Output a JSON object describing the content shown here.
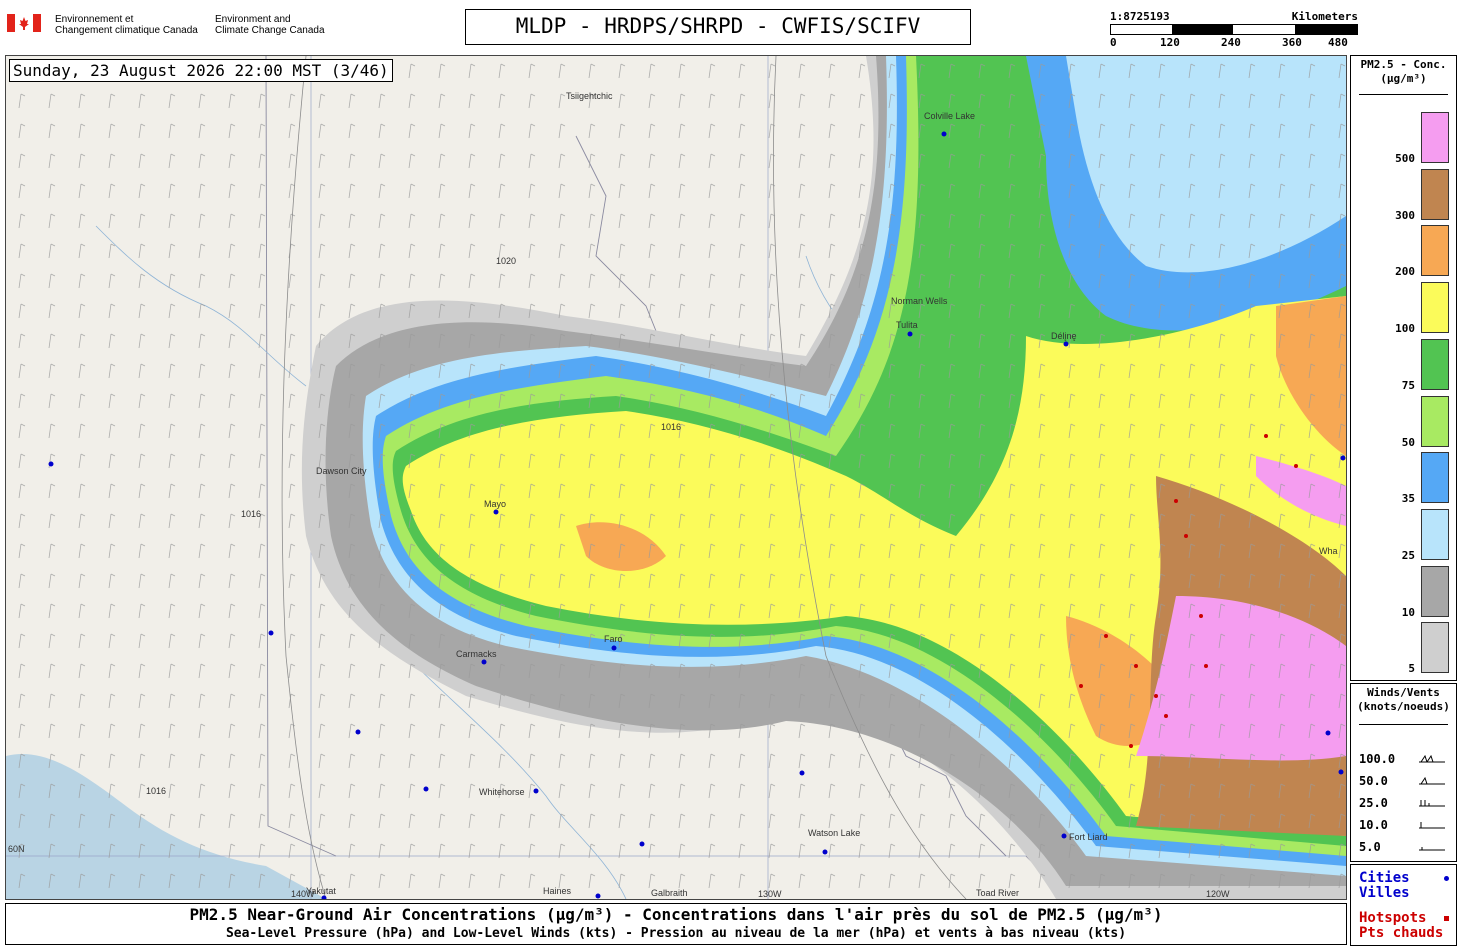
{
  "header": {
    "agency_fr_line1": "Environnement et",
    "agency_fr_line2": "Changement climatique Canada",
    "agency_en_line1": "Environment and",
    "agency_en_line2": "Climate Change Canada",
    "title": "MLDP - HRDPS/SHRPD - CWFIS/SCIFV",
    "scale_ratio": "1:8725193",
    "scale_unit": "Kilometers",
    "scale_ticks": [
      "0",
      "120",
      "240",
      "360",
      "480"
    ]
  },
  "map": {
    "datetime": "Sunday, 23 August 2026 22:00 MST (3/46)",
    "cities": [
      "Tsiigehtchic",
      "Colville Lake",
      "Norman Wells",
      "Tulita",
      "Délįnę",
      "Dawson City",
      "Mayo",
      "Carmacks",
      "Faro",
      "Whitehorse",
      "Watson Lake",
      "Fort Liard",
      "Yakutat",
      "Haines",
      "Galbraith",
      "Toad River",
      "Wha"
    ],
    "graticule_labels": [
      "60N",
      "130W",
      "120W",
      "140W"
    ],
    "isobar_labels": [
      "1016",
      "1020"
    ]
  },
  "legend": {
    "title_line1": "PM2.5 - Conc.",
    "title_line2": "(µg/m³)",
    "bins": [
      {
        "label": "500",
        "color": "#f59df0"
      },
      {
        "label": "300",
        "color": "#c08550"
      },
      {
        "label": "200",
        "color": "#f7a854"
      },
      {
        "label": "100",
        "color": "#fbfb5a"
      },
      {
        "label": "75",
        "color": "#52c452"
      },
      {
        "label": "50",
        "color": "#a8ea62"
      },
      {
        "label": "35",
        "color": "#55a8f5"
      },
      {
        "label": "25",
        "color": "#b8e4fb"
      },
      {
        "label": "10",
        "color": "#a7a7a7"
      },
      {
        "label": "5",
        "color": "#cfcfcf"
      }
    ]
  },
  "wind_legend": {
    "title_line1": "Winds/Vents",
    "title_line2": "(knots/noeuds)",
    "rows": [
      "100.0",
      "50.0",
      "25.0",
      "10.0",
      "5.0"
    ]
  },
  "cv_legend": {
    "cities_en": "Cities",
    "cities_fr": "Villes",
    "hotspots_en": "Hotspots",
    "hotspots_fr": "Pts chauds",
    "cities_color": "#0000cc",
    "hotspots_color": "#cc0000"
  },
  "footer": {
    "line1": "PM2.5 Near-Ground Air Concentrations (µg/m³) - Concentrations dans l'air près du sol de PM2.5 (µg/m³)",
    "line2": "Sea-Level Pressure (hPa) and Low-Level Winds (kts) - Pression au niveau de la mer (hPa) et vents à bas niveau (kts)"
  }
}
